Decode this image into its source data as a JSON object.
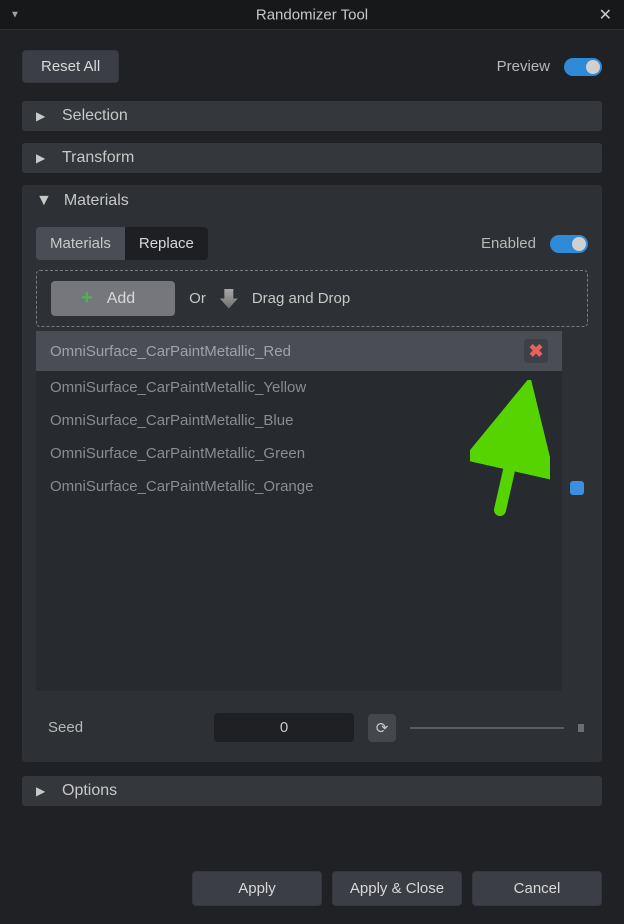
{
  "window": {
    "title": "Randomizer Tool"
  },
  "top": {
    "reset_label": "Reset All",
    "preview_label": "Preview"
  },
  "sections": {
    "selection_label": "Selection",
    "transform_label": "Transform",
    "materials_label": "Materials",
    "options_label": "Options"
  },
  "materials": {
    "tabs": {
      "materials": "Materials",
      "replace": "Replace"
    },
    "enabled_label": "Enabled",
    "add_label": "Add",
    "or_label": "Or",
    "drag_label": "Drag and Drop",
    "items": [
      "OmniSurface_CarPaintMetallic_Red",
      "OmniSurface_CarPaintMetallic_Yellow",
      "OmniSurface_CarPaintMetallic_Blue",
      "OmniSurface_CarPaintMetallic_Green",
      "OmniSurface_CarPaintMetallic_Orange"
    ]
  },
  "seed": {
    "label": "Seed",
    "value": "0"
  },
  "footer": {
    "apply": "Apply",
    "apply_close": "Apply & Close",
    "cancel": "Cancel"
  }
}
